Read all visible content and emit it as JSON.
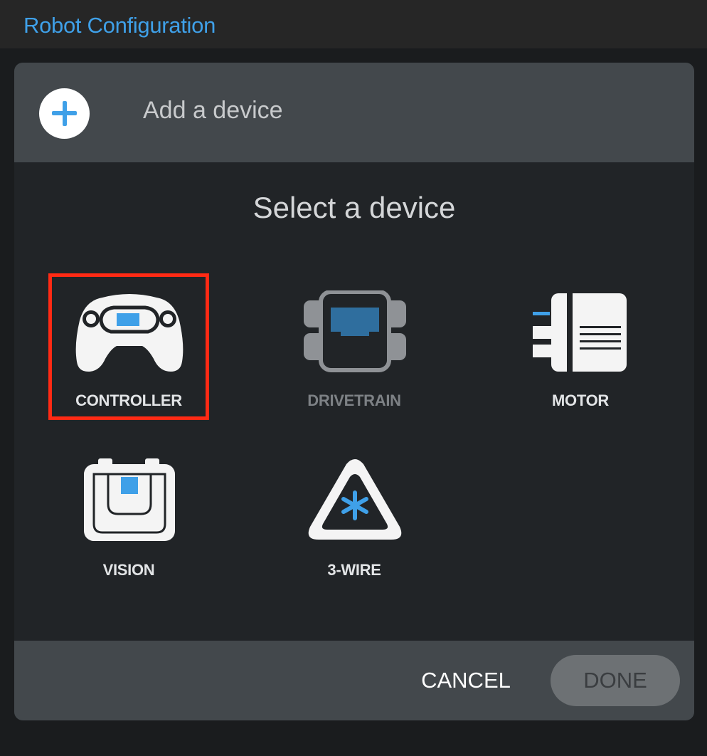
{
  "window": {
    "title": "Robot Configuration"
  },
  "header": {
    "label": "Add a device",
    "icon": "plus-icon"
  },
  "content": {
    "title": "Select a device"
  },
  "devices": [
    {
      "label": "CONTROLLER",
      "icon": "controller-icon",
      "selected": true
    },
    {
      "label": "DRIVETRAIN",
      "icon": "drivetrain-icon",
      "disabled": true
    },
    {
      "label": "MOTOR",
      "icon": "motor-icon"
    },
    {
      "label": "VISION",
      "icon": "vision-icon"
    },
    {
      "label": "3-WIRE",
      "icon": "three-wire-icon"
    }
  ],
  "footer": {
    "cancel_label": "CANCEL",
    "done_label": "DONE"
  },
  "colors": {
    "accent": "#3fa0e8",
    "selection": "#ff2a14",
    "panel": "#212427",
    "header": "#43484c"
  }
}
